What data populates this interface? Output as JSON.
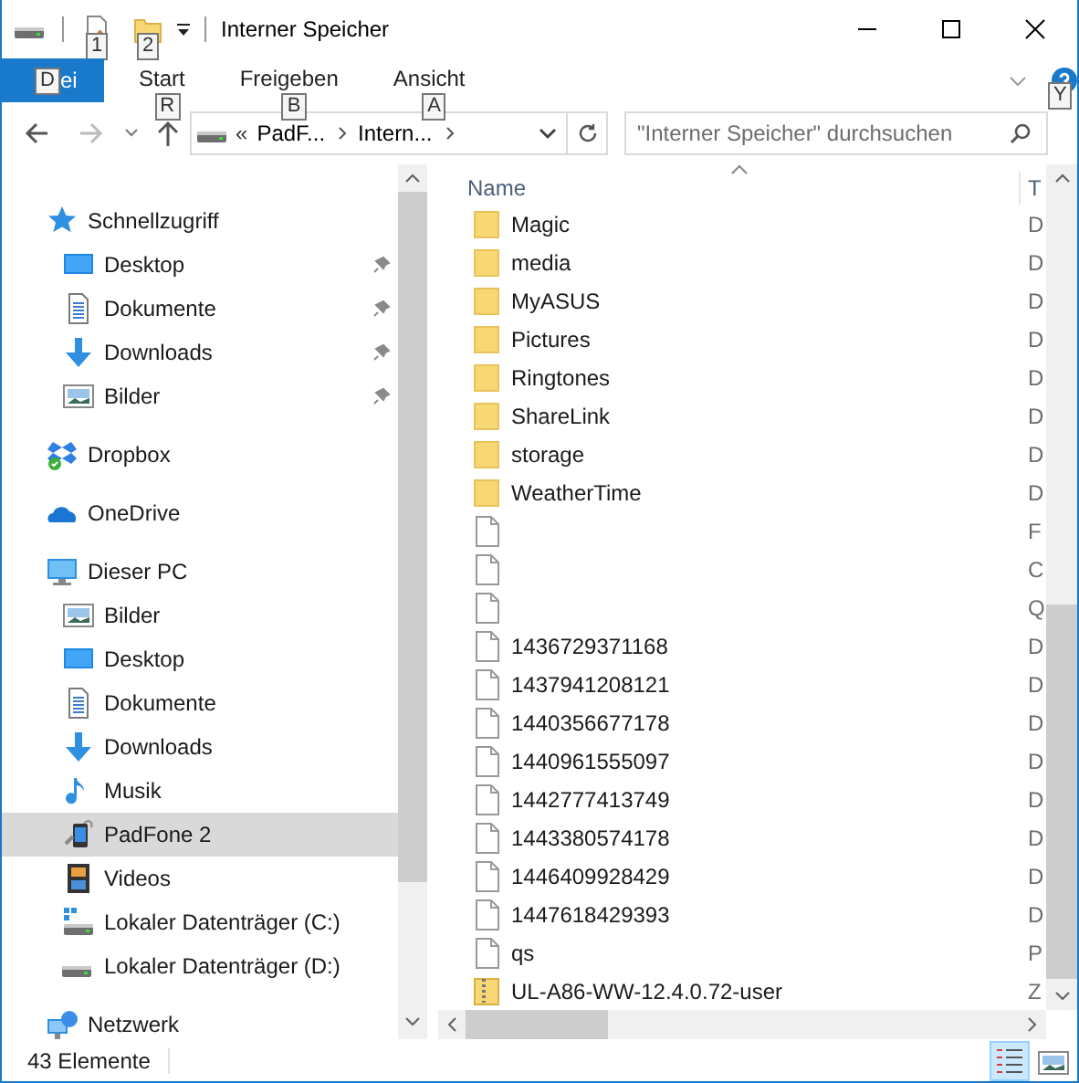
{
  "window": {
    "title": "Interner Speicher"
  },
  "quick_access_toolbar": [
    {
      "kind": "properties",
      "key_tip": "1"
    },
    {
      "kind": "new-folder",
      "key_tip": "2"
    }
  ],
  "ribbon_tabs": [
    {
      "label": "ei",
      "kind": "file",
      "key_tip": "D"
    },
    {
      "label": "Start",
      "kind": "tab",
      "key_tip": "R"
    },
    {
      "label": "Freigeben",
      "kind": "tab",
      "key_tip": "B"
    },
    {
      "label": "Ansicht",
      "kind": "tab",
      "key_tip": "A"
    }
  ],
  "help_key_tip": "Y",
  "address_bar": {
    "overflow": "«",
    "segments": [
      "PadF...",
      "Intern..."
    ]
  },
  "search": {
    "placeholder": "\"Interner Speicher\" durchsuchen"
  },
  "navigation": [
    {
      "label": "Schnellzugriff",
      "kind": "star",
      "selected": false,
      "children": [
        {
          "label": "Desktop",
          "kind": "desktop",
          "pinned": true,
          "selected": false
        },
        {
          "label": "Dokumente",
          "kind": "documents",
          "pinned": true,
          "selected": false
        },
        {
          "label": "Downloads",
          "kind": "download",
          "pinned": true,
          "selected": false
        },
        {
          "label": "Bilder",
          "kind": "pictures",
          "pinned": true,
          "selected": false
        }
      ]
    },
    {
      "label": "Dropbox",
      "kind": "dropbox",
      "selected": false
    },
    {
      "label": "OneDrive",
      "kind": "cloud",
      "selected": false
    },
    {
      "label": "Dieser PC",
      "kind": "pc",
      "selected": false,
      "children": [
        {
          "label": "Bilder",
          "kind": "pictures",
          "selected": false
        },
        {
          "label": "Desktop",
          "kind": "desktop",
          "selected": false
        },
        {
          "label": "Dokumente",
          "kind": "documents",
          "selected": false
        },
        {
          "label": "Downloads",
          "kind": "download",
          "selected": false
        },
        {
          "label": "Musik",
          "kind": "music",
          "selected": false
        },
        {
          "label": "PadFone 2",
          "kind": "phone",
          "selected": true
        },
        {
          "label": "Videos",
          "kind": "videos",
          "selected": false
        },
        {
          "label": "Lokaler Datenträger (C:)",
          "kind": "system-drive",
          "selected": false
        },
        {
          "label": "Lokaler Datenträger (D:)",
          "kind": "drive",
          "selected": false
        }
      ]
    },
    {
      "label": "Netzwerk",
      "kind": "network",
      "selected": false
    }
  ],
  "file_list": {
    "columns": [
      "Name",
      "T"
    ],
    "rows": [
      {
        "kind": "folder",
        "name": "Magic",
        "type": "D"
      },
      {
        "kind": "folder",
        "name": "media",
        "type": "D"
      },
      {
        "kind": "folder",
        "name": "MyASUS",
        "type": "D"
      },
      {
        "kind": "folder",
        "name": "Pictures",
        "type": "D"
      },
      {
        "kind": "folder",
        "name": "Ringtones",
        "type": "D"
      },
      {
        "kind": "folder",
        "name": "ShareLink",
        "type": "D"
      },
      {
        "kind": "folder",
        "name": "storage",
        "type": "D"
      },
      {
        "kind": "folder",
        "name": "WeatherTime",
        "type": "D"
      },
      {
        "kind": "file",
        "type": "F"
      },
      {
        "kind": "file",
        "type": "C"
      },
      {
        "kind": "file",
        "type": "Q"
      },
      {
        "kind": "file",
        "name": "1436729371168",
        "type": "D"
      },
      {
        "kind": "file",
        "name": "1437941208121",
        "type": "D"
      },
      {
        "kind": "file",
        "name": "1440356677178",
        "type": "D"
      },
      {
        "kind": "file",
        "name": "1440961555097",
        "type": "D"
      },
      {
        "kind": "file",
        "name": "1442777413749",
        "type": "D"
      },
      {
        "kind": "file",
        "name": "1443380574178",
        "type": "D"
      },
      {
        "kind": "file",
        "name": "1446409928429",
        "type": "D"
      },
      {
        "kind": "file",
        "name": "1447618429393",
        "type": "D"
      },
      {
        "kind": "file",
        "name": "qs",
        "type": "P"
      },
      {
        "kind": "zip",
        "name": "UL-A86-WW-12.4.0.72-user",
        "type": "Z"
      }
    ]
  },
  "status_bar": {
    "item_count": "43 Elemente",
    "views": [
      {
        "kind": "details",
        "selected": true
      },
      {
        "kind": "large-icons",
        "selected": false
      }
    ]
  }
}
